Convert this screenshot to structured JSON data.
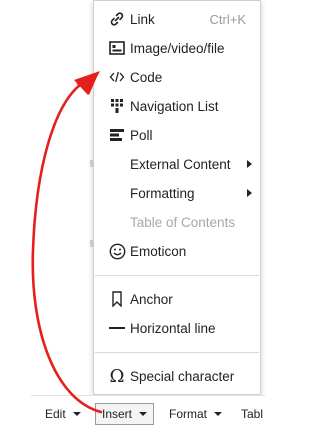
{
  "menu": {
    "items": [
      {
        "label": "Link",
        "shortcut": "Ctrl+K",
        "icon": "link-icon"
      },
      {
        "label": "Image/video/file",
        "icon": "image-icon"
      },
      {
        "label": "Code",
        "icon": "code-icon"
      },
      {
        "label": "Navigation List",
        "icon": "navigation-list-icon"
      },
      {
        "label": "Poll",
        "icon": "poll-icon"
      },
      {
        "label": "External Content",
        "submenu": true
      },
      {
        "label": "Formatting",
        "submenu": true
      },
      {
        "label": "Table of Contents",
        "disabled": true
      },
      {
        "label": "Emoticon",
        "icon": "emoticon-icon"
      },
      {
        "label": "Anchor",
        "icon": "bookmark-icon"
      },
      {
        "label": "Horizontal line",
        "icon": "horizontal-line-icon"
      },
      {
        "label": "Special character",
        "icon": "omega-icon"
      }
    ]
  },
  "toolbar": {
    "edit": "Edit",
    "insert": "Insert",
    "format": "Format",
    "table": "Tabl"
  },
  "colors": {
    "annotation_arrow": "#e5201c",
    "disabled_text": "#a8a8a8",
    "menu_border": "#cfcfcf"
  }
}
